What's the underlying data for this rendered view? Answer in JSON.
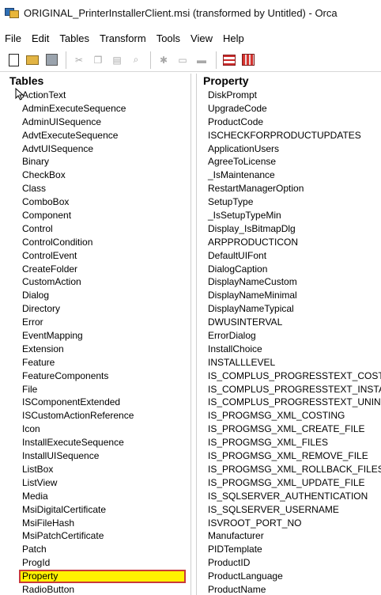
{
  "window": {
    "title": "ORIGINAL_PrinterInstallerClient.msi (transformed by Untitled) - Orca"
  },
  "menu": [
    "File",
    "Edit",
    "Tables",
    "Transform",
    "Tools",
    "View",
    "Help"
  ],
  "toolbar": {
    "icons": [
      "new-icon",
      "open-icon",
      "save-icon",
      "cut-icon",
      "copy-icon",
      "paste-icon",
      "find-icon",
      "validate-icon",
      "tables-icon",
      "rows-icon",
      "merge-icon",
      "transform-icon"
    ]
  },
  "tables_pane": {
    "header": "Tables",
    "items": [
      "ActionText",
      "AdminExecuteSequence",
      "AdminUISequence",
      "AdvtExecuteSequence",
      "AdvtUISequence",
      "Binary",
      "CheckBox",
      "Class",
      "ComboBox",
      "Component",
      "Control",
      "ControlCondition",
      "ControlEvent",
      "CreateFolder",
      "CustomAction",
      "Dialog",
      "Directory",
      "Error",
      "EventMapping",
      "Extension",
      "Feature",
      "FeatureComponents",
      "File",
      "ISComponentExtended",
      "ISCustomActionReference",
      "Icon",
      "InstallExecuteSequence",
      "InstallUISequence",
      "ListBox",
      "ListView",
      "Media",
      "MsiDigitalCertificate",
      "MsiFileHash",
      "MsiPatchCertificate",
      "Patch",
      "ProgId",
      "Property",
      "RadioButton"
    ],
    "selected": "Property"
  },
  "property_pane": {
    "header": "Property",
    "items": [
      "DiskPrompt",
      "UpgradeCode",
      "ProductCode",
      "ISCHECKFORPRODUCTUPDATES",
      "ApplicationUsers",
      "AgreeToLicense",
      "_IsMaintenance",
      "RestartManagerOption",
      "SetupType",
      "_IsSetupTypeMin",
      "Display_IsBitmapDlg",
      "ARPPRODUCTICON",
      "DefaultUIFont",
      "DialogCaption",
      "DisplayNameCustom",
      "DisplayNameMinimal",
      "DisplayNameTypical",
      "DWUSINTERVAL",
      "ErrorDialog",
      "InstallChoice",
      "INSTALLLEVEL",
      "IS_COMPLUS_PROGRESSTEXT_COST",
      "IS_COMPLUS_PROGRESSTEXT_INSTA",
      "IS_COMPLUS_PROGRESSTEXT_UNINS",
      "IS_PROGMSG_XML_COSTING",
      "IS_PROGMSG_XML_CREATE_FILE",
      "IS_PROGMSG_XML_FILES",
      "IS_PROGMSG_XML_REMOVE_FILE",
      "IS_PROGMSG_XML_ROLLBACK_FILES",
      "IS_PROGMSG_XML_UPDATE_FILE",
      "IS_SQLSERVER_AUTHENTICATION",
      "IS_SQLSERVER_USERNAME",
      "ISVROOT_PORT_NO",
      "Manufacturer",
      "PIDTemplate",
      "ProductID",
      "ProductLanguage",
      "ProductName"
    ]
  }
}
